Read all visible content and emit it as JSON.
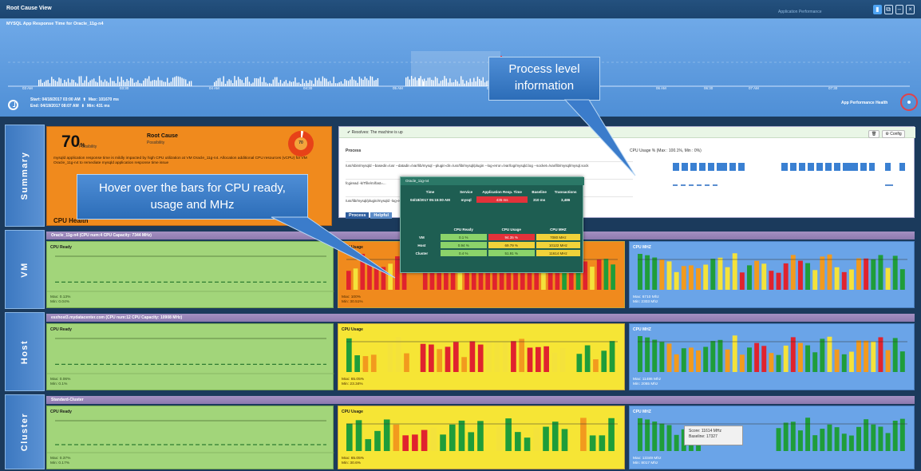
{
  "window": {
    "title": "Root Cause View",
    "corner_text": "Application Performance",
    "buttons": [
      "▮",
      "⧉",
      "–",
      "×"
    ]
  },
  "timeline": {
    "title": "MYSQL App Response Time for Oracle_11g-n4",
    "time_labels": [
      "03 AM",
      "03:30",
      "04 AM",
      "04:30",
      "05 AM",
      "05:30",
      "06 AM",
      "06:30",
      "07 AM",
      "07:30"
    ],
    "start": "Start: 04/18/2017 03:00 AM",
    "end": "End: 04/19/2017 08:07 AM",
    "max": "Max: 101670 ms",
    "min": "Min: 431 ms",
    "app_health_label": "App Performance Health"
  },
  "callouts": {
    "process": "Process level information",
    "hover": "Hover over the bars for CPU ready, usage and MHz"
  },
  "summary": {
    "section_label": "Summary",
    "score": "70",
    "score_unit": "%",
    "priority": "Possibility",
    "root_cause_title": "Root Cause",
    "root_cause_sub": "Possibility",
    "donut_label": "70",
    "description": "mysqld application response time is mildly impacted by high CPU utilization at VM Oracle_11g-n4. Allocation additional CPU resources (vCPU) for VM Oracle_11g-n4 to remediate mysqld application response time issue",
    "footer": "CPU Health"
  },
  "process_panel": {
    "status": "✔ Resolves: The machine is up",
    "btn_trash": "🗑",
    "btn_config": "⚙ Config",
    "col_process": "Process",
    "col_cpu": "CPU Usage %   (Max : 100.1%, Min : 0%)",
    "rows": [
      "/usr/sbin/mysqld --basedir=/usr --datadir=/var/lib/mysql --plugin-dir=/usr/lib/mysql/plugin --log-error=/var/log/mysqld.log --socket=/var/lib/mysql/mysql.sock",
      "fcgiread -k/Tfile/m/fast=...",
      "/usr/lib/mysql/plugin/mysqld -log-error/process58~mysql~NFW..."
    ],
    "tabs": [
      "Process",
      "Helpful"
    ]
  },
  "tooltip": {
    "title": "Oracle_11g-n4",
    "head": [
      "Time",
      "Service",
      "Application Resp. Time",
      "Baseline",
      "Transactions"
    ],
    "row": [
      "04/18/2017 05:15:00 AM",
      "mysql",
      "435 ms",
      "310 ms",
      "3,486"
    ],
    "sub_head": [
      "",
      "CPU Ready",
      "CPU Usage",
      "CPU MHZ"
    ],
    "vm": [
      "VM",
      "0.1 %",
      "94.35 %",
      "7080 MHz"
    ],
    "host": [
      "Host",
      "0.94 %",
      "69.79 %",
      "10122 MHz"
    ],
    "cluster": [
      "Cluster",
      "0.4 %",
      "51.91 %",
      "11614 MHz"
    ]
  },
  "vm": {
    "section_label": "VM",
    "strip": "Oracle_11g-n4  (CPU num:4  CPU Capacity: 7344 MHz)",
    "ready_title": "CPU Ready",
    "ready_max": "Max: 0.13%",
    "ready_min": "Min: 0.04%",
    "usage_title": "CPU Usage",
    "usage_max": "Max: 100%",
    "usage_min": "Min: 30.51%",
    "mhz_title": "CPU MHZ",
    "mhz_max": "Max: 6710 Mhz",
    "mhz_min": "Min: 2303 Mhz"
  },
  "host": {
    "section_label": "Host",
    "strip": "esxhost3.mydatacenter.com  (CPU num:12  CPU Capacity: 10908 MHz)",
    "ready_title": "CPU Ready",
    "ready_max": "Max: 0.06%",
    "ready_min": "Min: 0.1%",
    "usage_title": "CPU Usage",
    "usage_max": "Max: 65.05%",
    "usage_min": "Min: 23.34%",
    "mhz_title": "CPU MHZ",
    "mhz_max": "Max: 11486 Mhz",
    "mhz_min": "Min: 2065 Mhz"
  },
  "cluster": {
    "section_label": "Cluster",
    "strip": "Standard-Cluster",
    "ready_title": "CPU Ready",
    "ready_max": "Max: 0.37%",
    "ready_min": "Min: 0.17%",
    "usage_title": "CPU Usage",
    "usage_max": "Max: 65.05%",
    "usage_min": "Min: 30.6%",
    "mhz_title": "CPU MHZ",
    "mhz_max": "Max: 13349 Mhz",
    "mhz_min": "Min: 8017 Mhz",
    "hover_score": "Score: 11614 MHz",
    "hover_baseline": "Baseline: 17327"
  },
  "colors": {
    "green": "#1f9d3a",
    "red": "#e0232e",
    "orange": "#f29a1e",
    "yellow": "#f4e23b",
    "ready_bg": "#a2d57a",
    "mhz_bg": "#6aa4e8"
  }
}
